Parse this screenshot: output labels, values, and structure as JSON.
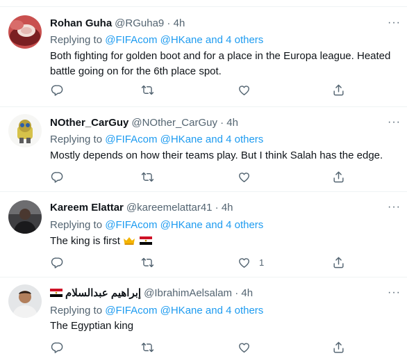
{
  "tweets": [
    {
      "display_name": "Rohan Guha",
      "handle_time": "@RGuha9 · 4h",
      "replying_prefix": "Replying to",
      "mention_1": "@FIFAcom",
      "mention_2": "@HKane",
      "mention_joiner": "and",
      "mention_others": "4 others",
      "text": "Both fighting for golden boot and for a place in the Europa league. Heated battle going on for the 6th place spot.",
      "like_count": ""
    },
    {
      "display_name": "NOther_CarGuy",
      "handle_time": "@NOther_CarGuy · 4h",
      "replying_prefix": "Replying to",
      "mention_1": "@FIFAcom",
      "mention_2": "@HKane",
      "mention_joiner": "and",
      "mention_others": "4 others",
      "text": "Mostly depends on how their teams play. But I think Salah has the edge.",
      "like_count": ""
    },
    {
      "display_name": "Kareem Elattar",
      "handle_time": "@kareemelattar41 · 4h",
      "replying_prefix": "Replying to",
      "mention_1": "@FIFAcom",
      "mention_2": "@HKane",
      "mention_joiner": "and",
      "mention_others": "4 others",
      "text": "The king is first",
      "like_count": "1"
    },
    {
      "display_name": "إبراهيم عبدالسلام",
      "handle_time": "@IbrahimAelsalam · 4h",
      "replying_prefix": "Replying to",
      "mention_1": "@FIFAcom",
      "mention_2": "@HKane",
      "mention_joiner": "and",
      "mention_others": "4 others",
      "text": "The Egyptian king",
      "like_count": ""
    }
  ],
  "icons": {
    "reply": "reply-icon",
    "retweet": "retweet-icon",
    "like": "heart-icon",
    "share": "share-icon",
    "more": "more-icon",
    "crown": "crown-emoji",
    "flag": "egypt-flag-emoji"
  },
  "colors": {
    "link": "#1d9bf0",
    "secondary_text": "#536471",
    "divider": "#eff3f4"
  }
}
